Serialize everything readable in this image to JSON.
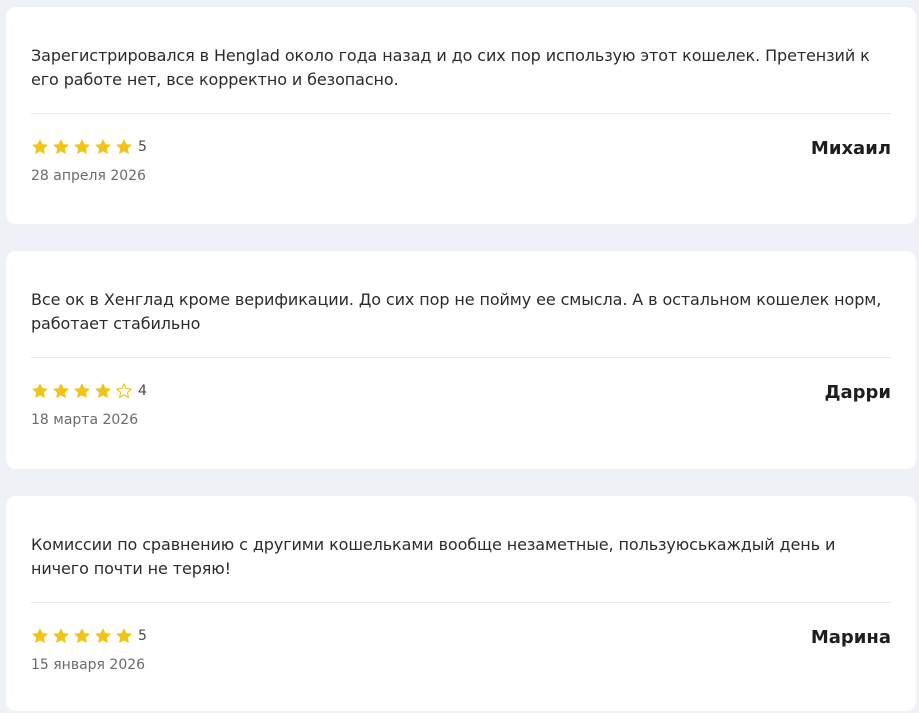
{
  "reviews": [
    {
      "text": "Зарегистрировался в Henglad около года назад и до сих пор использую этот кошелек. Претензий к его работе нет, все корректно и безопасно.",
      "rating": 5,
      "rating_label": "5",
      "date": "28 апреля 2026",
      "author": "Михаил"
    },
    {
      "text": "Все ок в Хенглад кроме верификации. До сих пор не пойму ее смысла. А в остальном кошелек норм, работает стабильно",
      "rating": 4,
      "rating_label": "4",
      "date": "18 марта 2026",
      "author": "Дарри"
    },
    {
      "text": "Комиссии по сравнению с другими кошельками вообще незаметные, пользуюськаждый день и ничего почти не теряю!",
      "rating": 5,
      "rating_label": "5",
      "date": "15 января 2026",
      "author": "Марина"
    }
  ],
  "colors": {
    "star": "#f0c419",
    "background": "#eef1f6",
    "card": "#ffffff"
  },
  "icons": {
    "filled_star": "star-filled-icon",
    "empty_star": "star-outline-icon"
  }
}
